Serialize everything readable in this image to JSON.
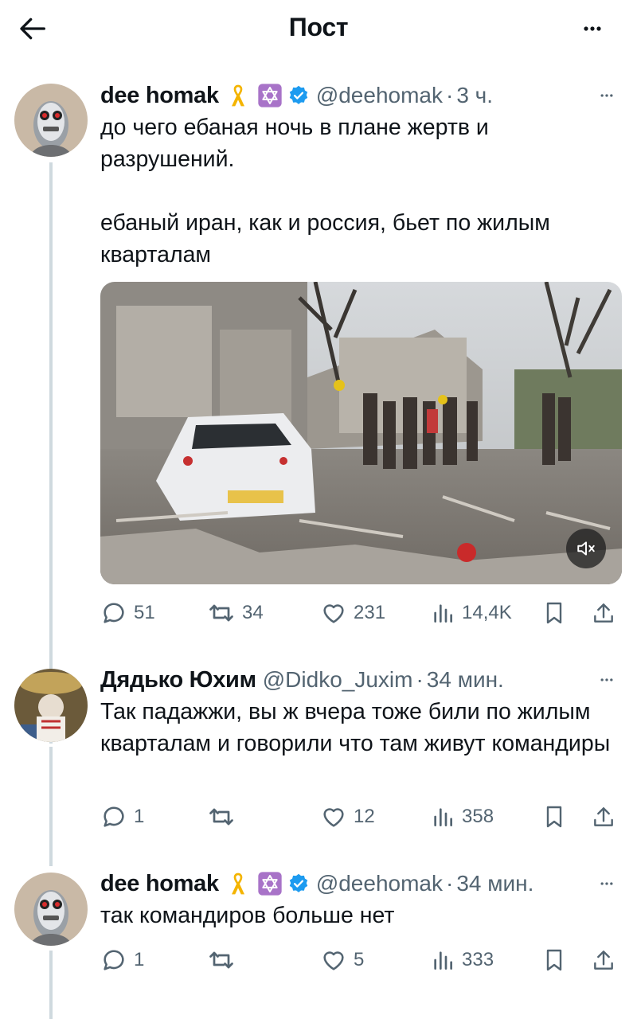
{
  "header": {
    "title": "Пост",
    "back_icon": "arrow-left-icon",
    "more_icon": "more-horizontal-icon"
  },
  "tweets": [
    {
      "name": "dee homak",
      "handle": "@deehomak",
      "time": "3 ч.",
      "badges": [
        "yellow-ribbon-icon",
        "star-of-david-icon",
        "verified-icon"
      ],
      "paragraphs": [
        "до чего ебаная ночь в плане жертв и разрушений.",
        "ебаный иран, как и россия, бьет по жилым кварталам"
      ],
      "media": {
        "type": "video",
        "description_icon": "video-thumbnail",
        "muted": true
      },
      "stats": {
        "replies": "51",
        "retweets": "34",
        "likes": "231",
        "views": "14,4K"
      }
    },
    {
      "name": "Дядько Юхим",
      "handle": "@Didko_Juxim",
      "time": "34 мин.",
      "badges": [],
      "paragraphs": [
        "Так падажжи, вы ж вчера тоже били по жилым кварталам и говорили что там живут командиры"
      ],
      "stats": {
        "replies": "1",
        "retweets": "",
        "likes": "12",
        "views": "358"
      }
    },
    {
      "name": "dee homak",
      "handle": "@deehomak",
      "time": "34 мин.",
      "badges": [
        "yellow-ribbon-icon",
        "star-of-david-icon",
        "verified-icon"
      ],
      "paragraphs": [
        "так командиров больше нет"
      ],
      "stats": {
        "replies": "1",
        "retweets": "",
        "likes": "5",
        "views": "333"
      }
    }
  ],
  "colors": {
    "text": "#0f1419",
    "secondary": "#536471",
    "verified": "#1d9bf0",
    "ribbon": "#f4b400",
    "line": "#cfd9de"
  },
  "separator": "·"
}
